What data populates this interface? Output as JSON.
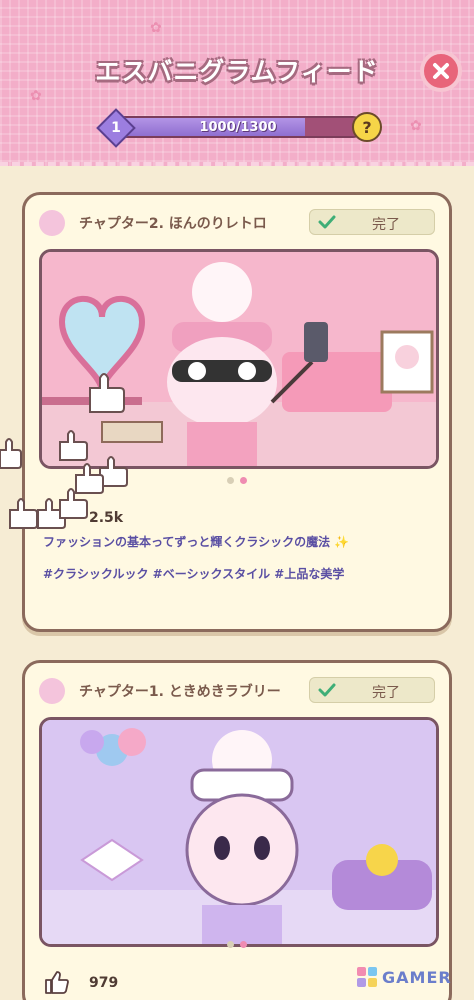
{
  "header": {
    "title": "エスバニグラムフィード",
    "level": "1",
    "progress_text": "1000/1300",
    "progress_fraction": 0.769,
    "help_label": "?",
    "close_icon": "close-icon"
  },
  "cards": [
    {
      "chapter": "チャプター2. ほんのりレトロ",
      "status": "完了",
      "likes": "2.5k",
      "caption": "ファッションの基本ってずっと輝くクラシックの魔法 ✨",
      "tags": "#クラシックルック #ベーシックスタイル #上品な美学"
    },
    {
      "chapter": "チャプター1. ときめきラブリー",
      "status": "完了",
      "likes": "979"
    }
  ],
  "watermark": "GAMER",
  "colors": {
    "header_pink": "#f3aec9",
    "background": "#f6ecd4",
    "progress_purple": "#8f6fd0",
    "close_red": "#e8647a",
    "text_purple": "#5a4fa3"
  }
}
